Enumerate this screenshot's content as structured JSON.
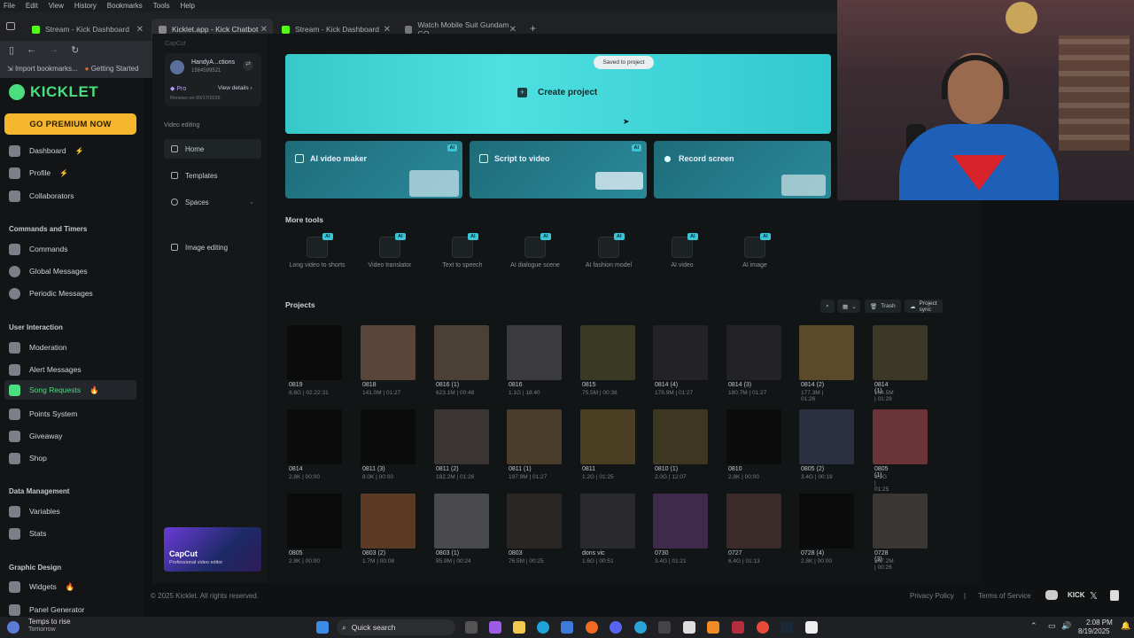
{
  "browser": {
    "menu": [
      "File",
      "Edit",
      "View",
      "History",
      "Bookmarks",
      "Tools",
      "Help"
    ],
    "tabs": [
      {
        "label": "Stream - Kick Dashboard"
      },
      {
        "label": "Kicklet.app - Kick Chatbot"
      },
      {
        "label": "Stream - Kick Dashboard"
      },
      {
        "label": "Watch Mobile Suit Gundam GQ"
      }
    ],
    "bookmarks": [
      "Import bookmarks...",
      "Getting Started"
    ]
  },
  "kicklet": {
    "logo": "KICKLET",
    "premium": "GO PREMIUM NOW",
    "nav": {
      "dashboard": "Dashboard",
      "profile": "Profile",
      "collaborators": "Collaborators",
      "sec_commands": "Commands and Timers",
      "commands": "Commands",
      "global_messages": "Global Messages",
      "periodic_messages": "Periodic Messages",
      "sec_user": "User Interaction",
      "moderation": "Moderation",
      "alert_messages": "Alert Messages",
      "song_requests": "Song Requests",
      "points_system": "Points System",
      "giveaway": "Giveaway",
      "shop": "Shop",
      "sec_data": "Data Management",
      "variables": "Variables",
      "stats": "Stats",
      "sec_graphic": "Graphic Design",
      "widgets": "Widgets",
      "panel_generator": "Panel Generator"
    },
    "footer": {
      "copyright": "© 2025 Kicklet. All rights reserved.",
      "privacy": "Privacy Policy",
      "sep": "|",
      "terms": "Terms of Service"
    }
  },
  "capcut": {
    "brand": "CapCut",
    "account": {
      "name": "HandyA...ctions",
      "id": "1584599521",
      "plan": "Pro",
      "details": "View details",
      "renews": "Renews on 09/17/2025"
    },
    "sec_video": "Video editing",
    "nav": {
      "home": "Home",
      "templates": "Templates",
      "spaces": "Spaces",
      "image": "Image editing"
    },
    "ad": {
      "title": "CapCut",
      "sub": "Professional video editor"
    },
    "toast": "Saved to project",
    "create": "Create project",
    "cards": [
      {
        "label": "AI video maker",
        "tag": "AI"
      },
      {
        "label": "Script to video",
        "tag": "AI"
      },
      {
        "label": "Record screen"
      }
    ],
    "more_tools": "More tools",
    "tools": [
      {
        "label": "Long video to shorts",
        "tag": "AI"
      },
      {
        "label": "Video translator",
        "tag": "AI"
      },
      {
        "label": "Text to speech",
        "tag": "AI"
      },
      {
        "label": "AI dialogue scene",
        "tag": "AI"
      },
      {
        "label": "AI fashion model",
        "tag": "AI"
      },
      {
        "label": "AI video",
        "tag": "AI"
      },
      {
        "label": "AI image",
        "tag": "AI"
      }
    ],
    "projects_title": "Projects",
    "trash": "Trash",
    "sync": "Project sync",
    "projects": [
      [
        {
          "name": "0819",
          "meta": "8.8G | 02:22:31",
          "c": "#0b0b0b"
        },
        {
          "name": "0818",
          "meta": "141.0M | 01:27",
          "c": "#5a4638"
        },
        {
          "name": "0816 (1)",
          "meta": "623.1M | 00:48",
          "c": "#4b4036"
        },
        {
          "name": "0816",
          "meta": "1.1G | 18:40",
          "c": "#3b3a3c"
        },
        {
          "name": "0815",
          "meta": "75.5M | 00:38",
          "c": "#3a3a24"
        },
        {
          "name": "0814 (4)",
          "meta": "178.9M | 01:27",
          "c": "#232224"
        },
        {
          "name": "0814 (3)",
          "meta": "180.7M | 01:27",
          "c": "#232224"
        },
        {
          "name": "0814 (2)",
          "meta": "177.3M | 01:26",
          "c": "#5b4a2a"
        },
        {
          "name": "0814 (1)",
          "meta": "164.5M | 01:28",
          "c": "#3c3826"
        }
      ],
      [
        {
          "name": "0814",
          "meta": "2.8K | 00:00",
          "c": "#0b0b0b"
        },
        {
          "name": "0811 (3)",
          "meta": "8.0K | 00:00",
          "c": "#0b0b0b"
        },
        {
          "name": "0811 (2)",
          "meta": "182.2M | 01:26",
          "c": "#3a3433"
        },
        {
          "name": "0811 (1)",
          "meta": "197.9M | 01:27",
          "c": "#4a3d2c"
        },
        {
          "name": "0811",
          "meta": "1.2G | 01:25",
          "c": "#4a3f22"
        },
        {
          "name": "0810 (1)",
          "meta": "2.0G | 12:07",
          "c": "#3d3620"
        },
        {
          "name": "0810",
          "meta": "2.8K | 00:00",
          "c": "#0b0b0b"
        },
        {
          "name": "0805 (2)",
          "meta": "3.4G | 00:19",
          "c": "#2a3040"
        },
        {
          "name": "0805 (1)",
          "meta": "4.5G | 01:25",
          "c": "#6a3438"
        }
      ],
      [
        {
          "name": "0805",
          "meta": "2.8K | 00:00",
          "c": "#0b0b0b"
        },
        {
          "name": "0803 (2)",
          "meta": "1.7M | 00:08",
          "c": "#5a3a25"
        },
        {
          "name": "0803 (1)",
          "meta": "85.9M | 00:24",
          "c": "#4a4a4e"
        },
        {
          "name": "0803",
          "meta": "76.5M | 00:25",
          "c": "#2a2624"
        },
        {
          "name": "dons vic",
          "meta": "1.6G | 00:51",
          "c": "#2a2a2e"
        },
        {
          "name": "0730",
          "meta": "3.4G | 01:21",
          "c": "#3e2a4a"
        },
        {
          "name": "0727",
          "meta": "6.4G | 01:13",
          "c": "#3a2a2a"
        },
        {
          "name": "0728 (4)",
          "meta": "2.8K | 00:00",
          "c": "#0b0b0b"
        },
        {
          "name": "0728 (3)",
          "meta": "307.2M | 00:26",
          "c": "#3a3634"
        }
      ]
    ]
  },
  "taskbar": {
    "weather": "Temps to rise",
    "weather_sub": "Tomorrow",
    "search": "Quick search",
    "time": "2:08 PM",
    "date": "8/19/2025"
  },
  "colors": {
    "accent": "#4ade80",
    "premium": "#f5b52e",
    "capcut_cyan": "#4ee0e0"
  }
}
